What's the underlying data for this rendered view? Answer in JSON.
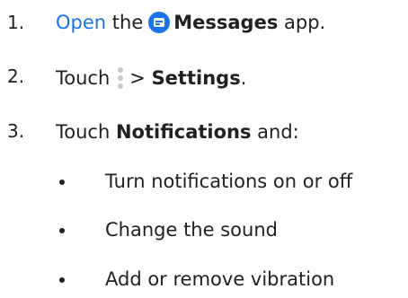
{
  "steps": [
    {
      "number": "1.",
      "link_text": "Open",
      "text_before_icon": " the",
      "app_icon": "messages-app-icon",
      "app_name": "Messages",
      "text_after": " app."
    },
    {
      "number": "2.",
      "text_before_icon": "Touch",
      "icon": "more-options-icon",
      "separator": "> ",
      "target": "Settings",
      "text_after": "."
    },
    {
      "number": "3.",
      "text_before": "Touch ",
      "target": "Notifications",
      "text_after": " and:",
      "bullets": [
        "Turn notifications on or off",
        "Change the sound",
        "Add or remove vibration"
      ]
    }
  ],
  "colors": {
    "link": "#1a73e8",
    "text": "#212121",
    "app_icon_bg": "#1a73e8"
  }
}
